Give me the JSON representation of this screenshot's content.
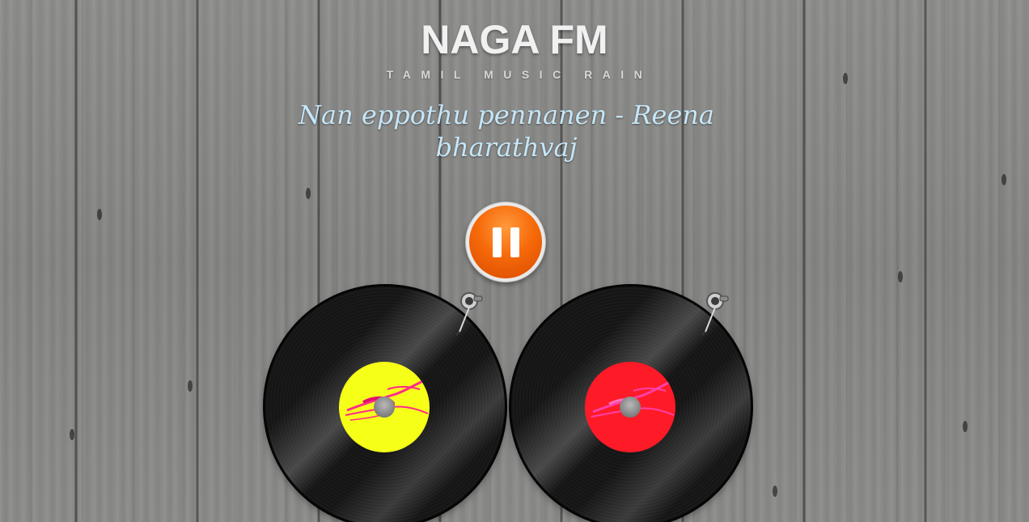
{
  "header": {
    "title": "NAGA FM",
    "tagline": "TAMIL MUSIC RAIN"
  },
  "now_playing": {
    "text": "Nan eppothu pennanen - Reena bharathvaj"
  },
  "player": {
    "pause_icon": "pause-icon",
    "state": "playing",
    "accent_color": "#f66a0a"
  },
  "decks": [
    {
      "label_color": "#f6ff18",
      "icon": "vinyl-record-icon"
    },
    {
      "label_color": "#ff1a28",
      "icon": "vinyl-record-icon"
    }
  ],
  "background": {
    "style": "grey wood planks"
  }
}
